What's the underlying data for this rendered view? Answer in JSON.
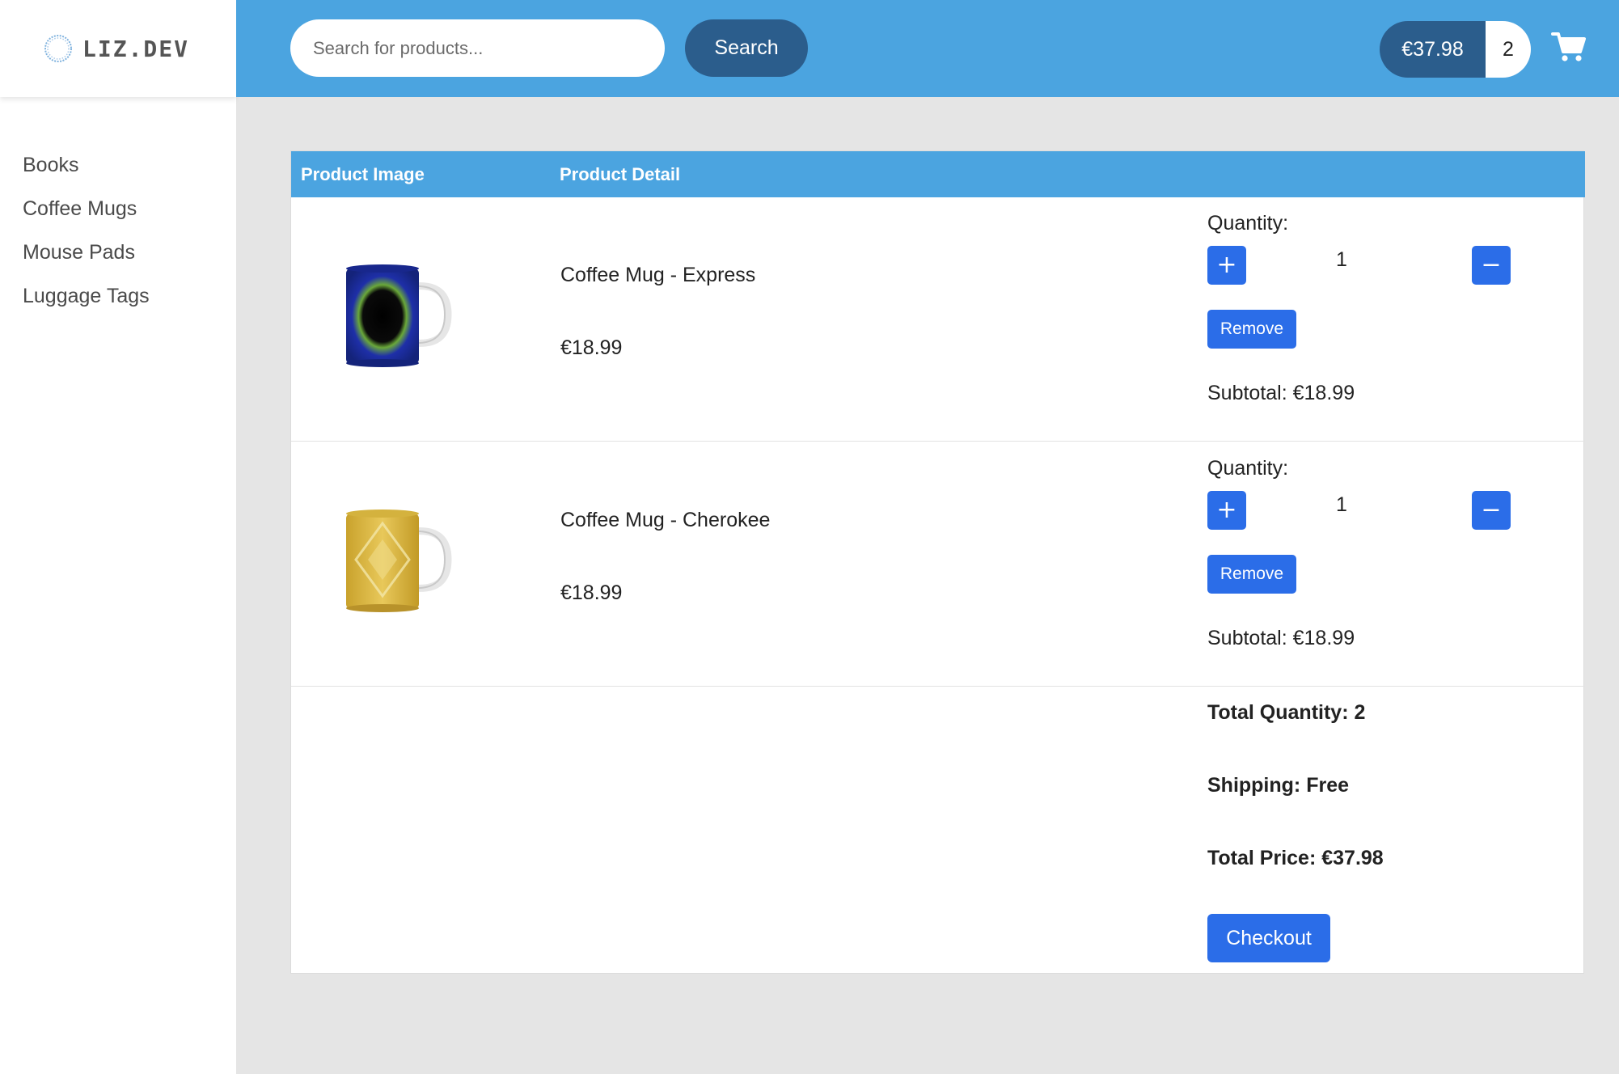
{
  "brand": {
    "name": "LIZ.DEV"
  },
  "sidebar": {
    "items": [
      {
        "label": "Books"
      },
      {
        "label": "Coffee Mugs"
      },
      {
        "label": "Mouse Pads"
      },
      {
        "label": "Luggage Tags"
      }
    ]
  },
  "header": {
    "search_placeholder": "Search for products...",
    "search_value": "",
    "search_label": "Search",
    "cart_total": "€37.98",
    "cart_count": "2",
    "cart_icon": "shopping-cart-icon"
  },
  "table": {
    "headers": {
      "image": "Product Image",
      "detail": "Product Detail"
    },
    "quantity_label": "Quantity:",
    "plus_symbol": "+",
    "minus_symbol": "−",
    "remove_label": "Remove",
    "items": [
      {
        "name": "Coffee Mug - Express",
        "price": "€18.99",
        "quantity": "1",
        "subtotal": "Subtotal: €18.99",
        "mug_color": "#1e2fa8"
      },
      {
        "name": "Coffee Mug - Cherokee",
        "price": "€18.99",
        "quantity": "1",
        "subtotal": "Subtotal: €18.99",
        "mug_color": "#d8b43a"
      }
    ]
  },
  "summary": {
    "total_quantity": "Total Quantity: 2",
    "shipping": "Shipping: Free",
    "total_price": "Total Price: €37.98",
    "checkout_label": "Checkout"
  },
  "colors": {
    "header": "#4ba4e0",
    "dark_accent": "#2b5d8c",
    "button": "#2b6de8",
    "background": "#e5e5e5"
  }
}
